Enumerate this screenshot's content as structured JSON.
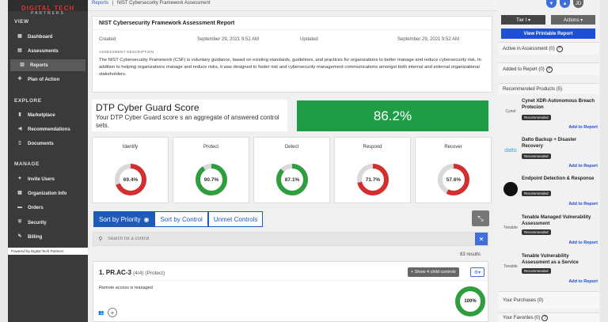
{
  "brand": {
    "logo_line1": "DIGITAL TECH",
    "logo_line2": "PARTNERS",
    "powered_by": "Powered by Digital Tech Partners"
  },
  "breadcrumb": {
    "root": "Reports",
    "sep": "|",
    "current": "NIST Cybersecurity Framework Assessment"
  },
  "sidebar": {
    "sections": [
      {
        "title": "VIEW",
        "items": [
          {
            "label": "Dashboard",
            "icon": "dashboard-icon"
          },
          {
            "label": "Assessments",
            "icon": "assessments-icon"
          },
          {
            "label": "Reports",
            "icon": "reports-icon",
            "active": true
          },
          {
            "label": "Plan of Action",
            "icon": "pin-icon"
          }
        ]
      },
      {
        "title": "EXPLORE",
        "items": [
          {
            "label": "Marketplace",
            "icon": "marketplace-icon"
          },
          {
            "label": "Recommendations",
            "icon": "megaphone-icon"
          },
          {
            "label": "Documents",
            "icon": "document-icon"
          }
        ]
      },
      {
        "title": "MANAGE",
        "items": [
          {
            "label": "Invite Users",
            "icon": "invite-user-icon"
          },
          {
            "label": "Organization Info",
            "icon": "organization-icon"
          },
          {
            "label": "Orders",
            "icon": "orders-icon"
          },
          {
            "label": "Security",
            "icon": "shield-icon"
          },
          {
            "label": "Billing",
            "icon": "billing-icon"
          }
        ]
      }
    ]
  },
  "report": {
    "title": "NIST Cybersecurity Framework Assessment Report",
    "created_label": "Created",
    "created_value": "September 29, 2021 9:52 AM",
    "updated_label": "Updated",
    "updated_value": "September 29, 2021 9:52 AM",
    "desc_label": "ASSESSMENT DESCRIPTION",
    "description": "The NIST Cybersecurity Framework (CSF) is voluntary guidance, based on existing standards, guidelines, and practices for organizations to better manage and reduce cybersecurity risk. In addition to helping organizations manage and reduce risks, it was designed to foster risk and cybersecurity management communications amongst both internal and external organizational stakeholders."
  },
  "score": {
    "title": "DTP Cyber Guard Score",
    "subtitle": "Your DTP Cyber Guard score s an aggregate of answered control sets.",
    "value": "86.2%",
    "color": "#1f9d46"
  },
  "gauges": [
    {
      "label": "Identify",
      "value": 69.4,
      "text": "69.4%",
      "color": "#d32f2f"
    },
    {
      "label": "Protect",
      "value": 90.7,
      "text": "90.7%",
      "color": "#2e9e3e"
    },
    {
      "label": "Detect",
      "value": 87.1,
      "text": "87.1%",
      "color": "#2e9e3e"
    },
    {
      "label": "Respond",
      "value": 71.7,
      "text": "71.7%",
      "color": "#d32f2f"
    },
    {
      "label": "Recover",
      "value": 57.6,
      "text": "57.6%",
      "color": "#d32f2f"
    }
  ],
  "sort": {
    "priority": "Sort by Priority",
    "control": "Sort by Control",
    "unmet": "Unmet Controls"
  },
  "search": {
    "placeholder": "Search for a control",
    "results": "83 results"
  },
  "control": {
    "title": "1. PR.AC-3",
    "meta": "(4/4) (Protect)",
    "show_label": "+ Show 4 child controls",
    "text": "Remote access is managed",
    "value": 100,
    "text_value": "100%",
    "color": "#2e9e3e"
  },
  "right": {
    "tier_label": "Tier I ▾",
    "actions_label": "Actions ▾",
    "print_label": "View Printable Report",
    "active_label": "Active in Assessment (0)",
    "added_label": "Added to Report (0)",
    "recommended_label": "Recommended Products (5)",
    "purchases_label": "Your Purchases (0)",
    "favorites_label": "Your Favorites (0)",
    "avatar": "JD",
    "products": [
      {
        "name": "Cynet XDR-Autonomous Breach Protecion",
        "logo": "Cynet",
        "badge": "Recommended",
        "add": "Add to Report"
      },
      {
        "name": "Datto Backup + Disaster Recovery",
        "logo": "datto",
        "badge": "Recommended",
        "add": "Add to Report"
      },
      {
        "name": "Endpoint Detection & Response",
        "logo": "",
        "badge": "Recommended",
        "add": "Add to Report"
      },
      {
        "name": "Tenable Managed Vulnerability Assessment",
        "logo": "Tenable",
        "badge": "Recommended",
        "add": "Add to Report"
      },
      {
        "name": "Tenable Vulnerability Assessment as a Service",
        "logo": "Tenable",
        "badge": "Recommended",
        "add": "Add to Report"
      }
    ]
  }
}
